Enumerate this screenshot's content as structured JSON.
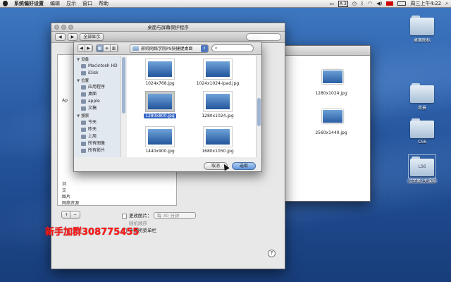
{
  "menubar": {
    "app": "系统偏好设置",
    "items": [
      "编辑",
      "显示",
      "窗口",
      "帮助"
    ],
    "clock": "周三上午4:22",
    "input_badge": "A 3"
  },
  "desktop_icons": [
    {
      "label": "桌面图标"
    },
    {
      "label": "背景"
    },
    {
      "label": "CS6"
    },
    {
      "label": "试学第2天课程"
    }
  ],
  "folder_overlay_text": "LS6",
  "prefs": {
    "title": "桌面与屏幕保护程序",
    "show_all": "全部显示",
    "left_rows": [
      "Ap",
      "",
      "",
      "",
      "",
      "",
      "",
      "",
      "",
      "",
      "",
      "",
      "",
      "",
      "",
      "",
      "",
      "浏",
      "文",
      "图片",
      "网络资源"
    ],
    "change_picture": "更改图片：",
    "interval": "每 30 分钟",
    "random": "随机顺序",
    "translucent_menu": "半透明菜单栏",
    "add": "+",
    "remove": "−",
    "help": "?"
  },
  "sheet": {
    "path": "邢帅网络学院PS快捷键桌面",
    "sidebar": {
      "devices_header": "▼ 设备",
      "devices": [
        "Macintosh HD",
        "iDisk"
      ],
      "places_header": "▼ 位置",
      "places": [
        "应用程序",
        "桌面",
        "apple",
        "文稿"
      ],
      "search_header": "▼ 搜索",
      "search": [
        "今天",
        "昨天",
        "上周",
        "所有图像",
        "所有影片"
      ]
    },
    "files": [
      {
        "name": "1024x768.jpg"
      },
      {
        "name": "1024x1024-ipad.jpg"
      },
      {
        "name": "1280x800.jpg",
        "selected": true
      },
      {
        "name": "1280x1024.jpg"
      },
      {
        "name": "1440x900.jpg"
      },
      {
        "name": "1680x1050.jpg"
      }
    ],
    "cancel": "取消",
    "choose": "选取"
  },
  "finder_bg": {
    "files": [
      "1280x1024.jpg",
      "2560x1440.jpg"
    ]
  },
  "watermark": "新手加群308775455"
}
